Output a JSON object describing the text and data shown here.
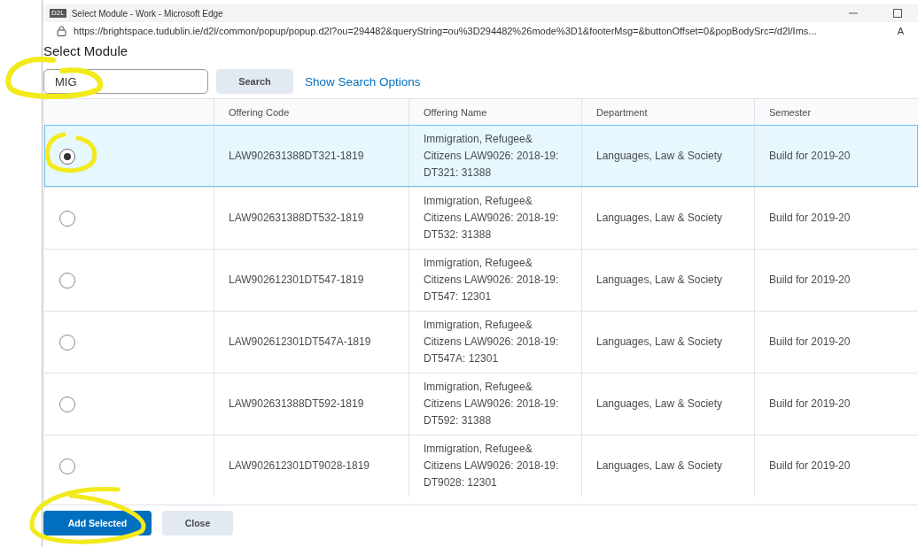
{
  "window": {
    "app_icon": "D2L",
    "title": "Select Module - Work - Microsoft Edge",
    "address": "https://brightspace.tudublin.ie/d2l/common/popup/popup.d2l?ou=294482&queryString=ou%3D294482%26mode%3D1&footerMsg=&buttonOffset=0&popBodySrc=/d2l/Ims...",
    "address_extra": "A"
  },
  "page_title": "Select Module",
  "search": {
    "value": "MIG",
    "button": "Search",
    "options_link": "Show Search Options"
  },
  "table": {
    "columns": [
      "Offering Code",
      "Offering Name",
      "Department",
      "Semester"
    ],
    "rows": [
      {
        "selected": true,
        "code": "LAW902631388DT321-1819",
        "name": "Immigration, Refugee& Citizens LAW9026: 2018-19: DT321: 31388",
        "department": "Languages, Law & Society",
        "semester": "Build for 2019-20"
      },
      {
        "selected": false,
        "code": "LAW902631388DT532-1819",
        "name": "Immigration, Refugee& Citizens LAW9026: 2018-19: DT532: 31388",
        "department": "Languages, Law & Society",
        "semester": "Build for 2019-20"
      },
      {
        "selected": false,
        "code": "LAW902612301DT547-1819",
        "name": "Immigration, Refugee& Citizens LAW9026: 2018-19: DT547: 12301",
        "department": "Languages, Law & Society",
        "semester": "Build for 2019-20"
      },
      {
        "selected": false,
        "code": "LAW902612301DT547A-1819",
        "name": "Immigration, Refugee& Citizens LAW9026: 2018-19: DT547A: 12301",
        "department": "Languages, Law & Society",
        "semester": "Build for 2019-20"
      },
      {
        "selected": false,
        "code": "LAW902631388DT592-1819",
        "name": "Immigration, Refugee& Citizens LAW9026: 2018-19: DT592: 31388",
        "department": "Languages, Law & Society",
        "semester": "Build for 2019-20"
      },
      {
        "selected": false,
        "code": "LAW902612301DT9028-1819",
        "name": "Immigration, Refugee& Citizens LAW9026: 2018-19: DT9028: 12301",
        "department": "Languages, Law & Society",
        "semester": "Build for 2019-20"
      }
    ]
  },
  "buttons": [
    {
      "label": "Add Selected",
      "kind": "primary"
    },
    {
      "label": "Close",
      "kind": "secondary"
    }
  ]
}
